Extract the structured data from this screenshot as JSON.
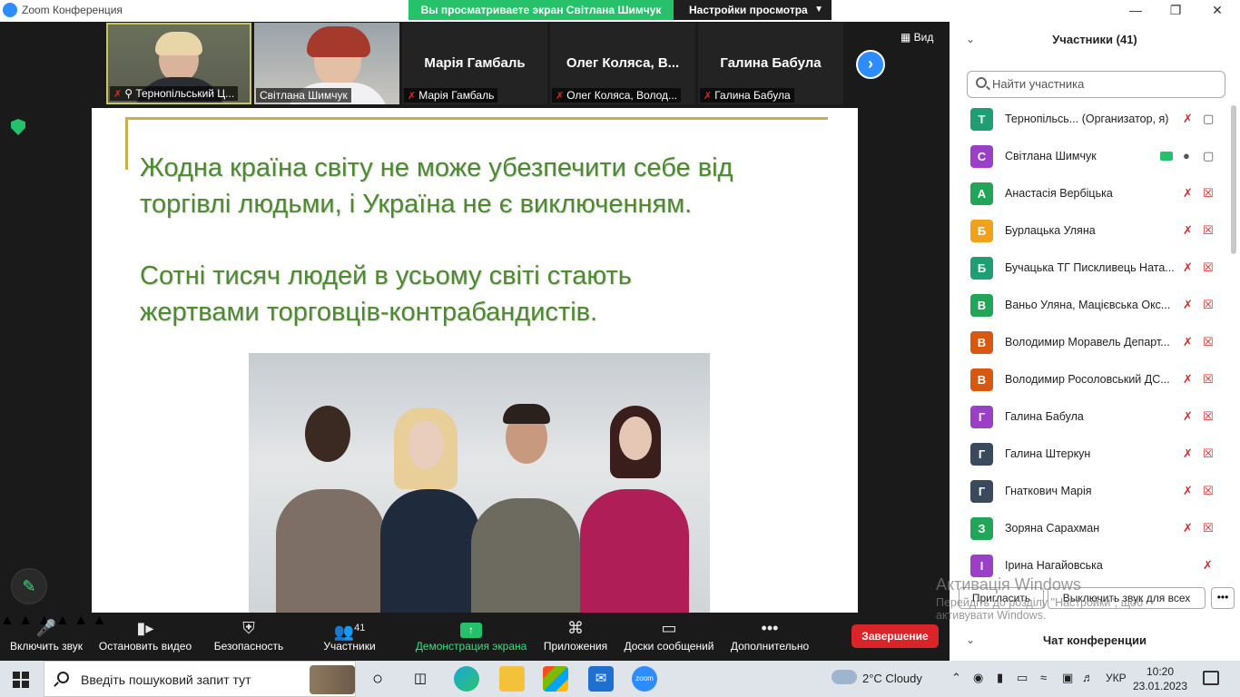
{
  "window": {
    "title": "Zoom Конференция",
    "minimize": "—",
    "restore": "❐",
    "close": "✕"
  },
  "share_banner": {
    "text": "Вы просматриваете экран Світлана Шимчук",
    "view_options": "Настройки просмотра"
  },
  "tiles": [
    {
      "label": "Тернопільський Ц..."
    },
    {
      "label": "Світлана Шимчук"
    },
    {
      "big_name": "Марія Гамбаль",
      "label": "Марія Гамбаль"
    },
    {
      "big_name": "Олег Коляса, В...",
      "label": "Олег Коляса, Волод..."
    },
    {
      "big_name": "Галина Бабула",
      "label": "Галина Бабула"
    }
  ],
  "view_button": "Вид",
  "slide": {
    "para1_line1": "Жодна країна світу не може убезпечити себе від",
    "para1_line2": "торгівлі людьми, і Україна не є виключенням.",
    "para2_line1": "Сотні тисяч людей в усьому світі стають",
    "para2_line2": "жертвами торговців-контрабандистів."
  },
  "panel": {
    "header": "Участники (41)",
    "search_placeholder": "Найти участника",
    "participants": [
      {
        "initial": "Т",
        "color": "#1f9e74",
        "name": "Тернопільсь...",
        "role": "(Организатор, я)"
      },
      {
        "initial": "С",
        "color": "#9b3fc9",
        "name": "Світлана Шимчук"
      },
      {
        "initial": "А",
        "color": "#21a558",
        "name": "Анастасія Вербіцька"
      },
      {
        "initial": "Б",
        "color": "#f0a21b",
        "name": "Бурлацька Уляна"
      },
      {
        "initial": "Б",
        "color": "#1f9e74",
        "name": "Бучацька ТГ Пискливець Ната..."
      },
      {
        "initial": "В",
        "color": "#21a558",
        "name": "Ваньо Уляна, Мацієвська Окс..."
      },
      {
        "initial": "В",
        "color": "#d9580f",
        "name": "Володимир Моравель Департ..."
      },
      {
        "initial": "В",
        "color": "#d9580f",
        "name": "Володимир Росоловський ДС..."
      },
      {
        "initial": "Г",
        "color": "#9b3fc9",
        "name": "Галина Бабула"
      },
      {
        "initial": "Г",
        "color": "#3a4a5c",
        "name": "Галина Штеркун"
      },
      {
        "initial": "Г",
        "color": "#3a4a5c",
        "name": "Гнаткович Марія"
      },
      {
        "initial": "З",
        "color": "#21a558",
        "name": "Зоряна Сарахман"
      },
      {
        "initial": "І",
        "color": "#9b3fc9",
        "name": "Ірина Нагайовська"
      }
    ],
    "invite": "Пригласить",
    "mute_all": "Выключить звук для всех",
    "more": "•••",
    "chat_header": "Чат конференции"
  },
  "activation": {
    "title": "Активація Windows",
    "line1": "Перейдіть до розділу \"Настройки\", щоб",
    "line2": "активувати Windows."
  },
  "toolbar": {
    "unmute": "Включить звук",
    "stop_video": "Остановить видео",
    "security": "Безопасность",
    "participants": "Участники",
    "participants_count": "41",
    "share": "Демонстрация экрана",
    "apps": "Приложения",
    "whiteboards": "Доски сообщений",
    "more": "Дополнительно",
    "end": "Завершение"
  },
  "taskbar": {
    "search_placeholder": "Введіть пошуковий запит тут",
    "weather": "2°C  Cloudy",
    "lang": "УКР",
    "time": "10:20",
    "date": "23.01.2023",
    "zoom_label": "zoom"
  },
  "colors": {
    "accent_green": "#26c16a",
    "zoom_blue": "#2d8cff",
    "end_red": "#d9242a",
    "slide_text_green": "#4d8a2f"
  }
}
